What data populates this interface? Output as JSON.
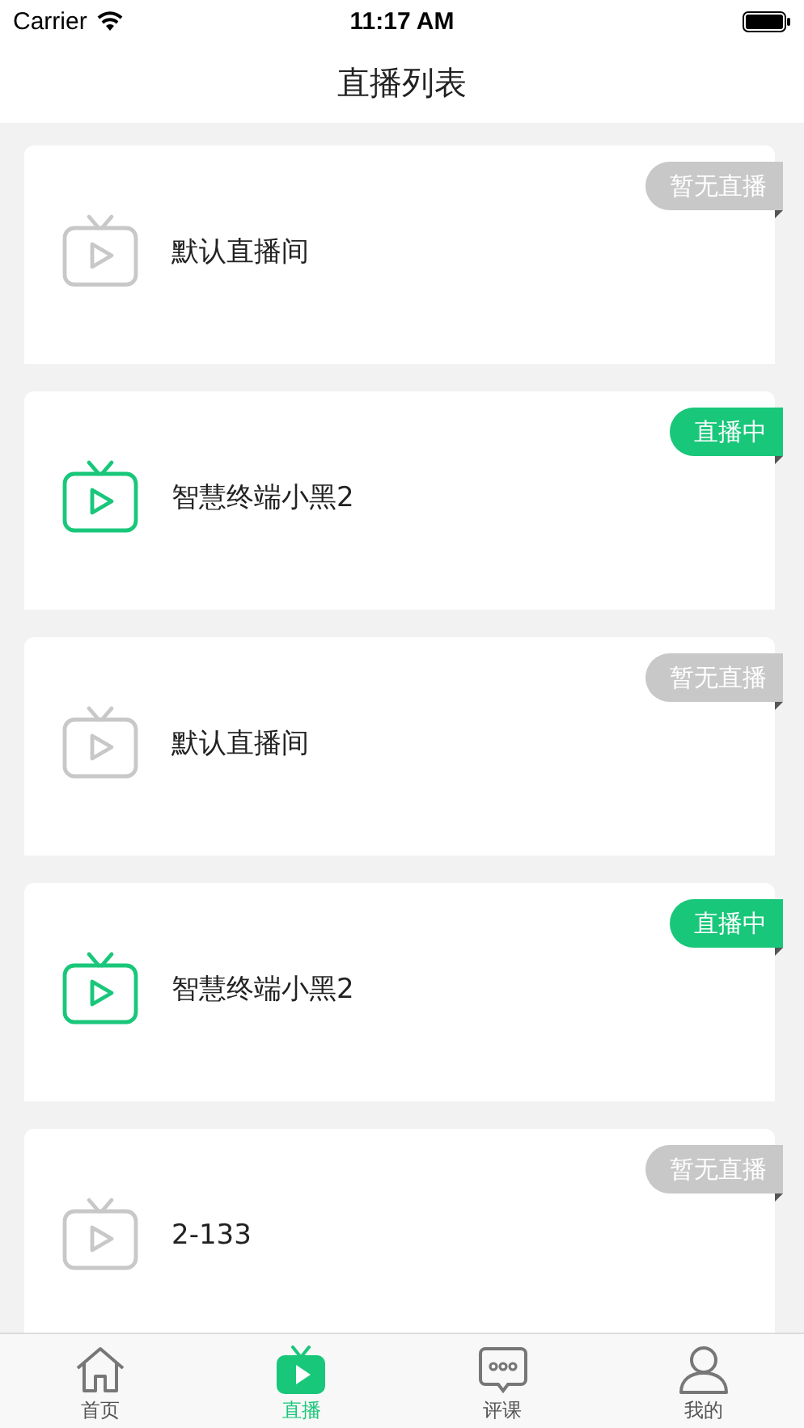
{
  "status_bar": {
    "carrier": "Carrier",
    "time": "11:17 AM"
  },
  "nav": {
    "title": "直播列表"
  },
  "rooms": [
    {
      "name": "默认直播间",
      "live": false,
      "badge": "暂无直播"
    },
    {
      "name": "智慧终端小黑2",
      "live": true,
      "badge": "直播中"
    },
    {
      "name": "默认直播间",
      "live": false,
      "badge": "暂无直播"
    },
    {
      "name": "智慧终端小黑2",
      "live": true,
      "badge": "直播中"
    },
    {
      "name": "2-133",
      "live": false,
      "badge": "暂无直播"
    }
  ],
  "tab_bar": [
    {
      "label": "首页",
      "kind": "home",
      "selected": false
    },
    {
      "label": "直播",
      "kind": "live",
      "selected": true
    },
    {
      "label": "评课",
      "kind": "comment",
      "selected": false
    },
    {
      "label": "我的",
      "kind": "profile",
      "selected": false
    }
  ]
}
